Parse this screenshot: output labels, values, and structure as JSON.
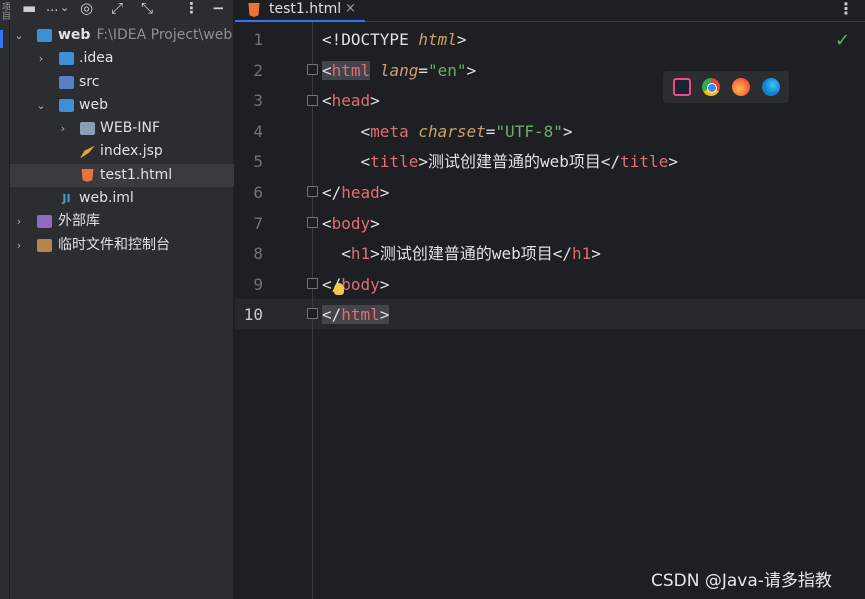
{
  "sidebar": {
    "vertical_label": "项目",
    "toolbar": [
      "..."
    ],
    "tree": [
      {
        "name": "web",
        "path": "F:\\IDEA Project\\web",
        "expanded": true,
        "icon": "module-folder-icon"
      },
      {
        "name": ".idea",
        "expanded": false,
        "icon": "folder-icon"
      },
      {
        "name": "src",
        "icon": "source-folder-icon"
      },
      {
        "name": "web",
        "expanded": true,
        "icon": "web-folder-icon"
      },
      {
        "name": "WEB-INF",
        "expanded": false,
        "icon": "folder-icon"
      },
      {
        "name": "index.jsp",
        "icon": "jsp-file-icon"
      },
      {
        "name": "test1.html",
        "icon": "html-file-icon",
        "selected": true
      },
      {
        "name": "web.iml",
        "icon": "iml-file-icon"
      },
      {
        "name": "外部库",
        "expanded": false,
        "icon": "library-icon"
      },
      {
        "name": "临时文件和控制台",
        "expanded": false,
        "icon": "scratches-icon"
      }
    ]
  },
  "editor": {
    "tab": {
      "label": "test1.html",
      "close": "×"
    },
    "menu": "⋮",
    "check": "✓",
    "line_numbers": [
      "1",
      "2",
      "3",
      "4",
      "5",
      "6",
      "7",
      "8",
      "9",
      "10"
    ],
    "current_line": "10",
    "lines": [
      {
        "p1": "<!DOCTYPE ",
        "p2": "html",
        "p3": ">"
      },
      {
        "p1": "<",
        "p2": "html",
        "p3": " ",
        "p4": "lang",
        "p5": "=",
        "p6": "\"en\"",
        "p7": ">"
      },
      {
        "p1": "<",
        "p2": "head",
        "p3": ">"
      },
      {
        "p0": "    ",
        "p1": "<",
        "p2": "meta",
        "p3": " ",
        "p4": "charset",
        "p5": "=",
        "p6": "\"UTF-8\"",
        "p7": ">"
      },
      {
        "p0": "    ",
        "p1": "<",
        "p2": "title",
        "p3": ">",
        "p4": "测试创建普通的web项目",
        "p5": "</",
        "p6": "title",
        "p7": ">"
      },
      {
        "p1": "</",
        "p2": "head",
        "p3": ">"
      },
      {
        "p1": "<",
        "p2": "body",
        "p3": ">"
      },
      {
        "p0": "  ",
        "p1": "<",
        "p2": "h1",
        "p3": ">",
        "p4": "测试创建普通的web项目",
        "p5": "</",
        "p6": "h1",
        "p7": ">"
      },
      {
        "p1": "</",
        "p2": "body",
        "p3": ">"
      },
      {
        "p1": "</",
        "p2": "html",
        "p3": ">"
      }
    ],
    "browsers": [
      "intellij-icon",
      "chrome-icon",
      "firefox-icon",
      "edge-icon"
    ]
  },
  "watermark": "CSDN @Java-请多指教",
  "colors": {
    "accent": "#3574f0",
    "tag": "#e06c75",
    "string": "#6aab73",
    "attribute": "#cba06b"
  }
}
